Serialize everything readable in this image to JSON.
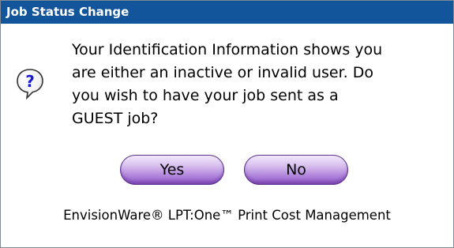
{
  "window": {
    "title": "Job Status Change"
  },
  "icon": {
    "name": "question-icon",
    "glyph": "?"
  },
  "message": {
    "lines": [
      "Your Identification Information shows you",
      "are either an inactive or invalid user. Do",
      "you wish to have your job sent as a",
      "GUEST job?"
    ]
  },
  "buttons": {
    "yes_label": "Yes",
    "no_label": "No"
  },
  "footer": {
    "text": "EnvisionWare® LPT:One™ Print Cost Management"
  },
  "colors": {
    "titlebar": "#12559a",
    "button_purple": "#b184dc",
    "icon_blue": "#1b1bd0"
  }
}
